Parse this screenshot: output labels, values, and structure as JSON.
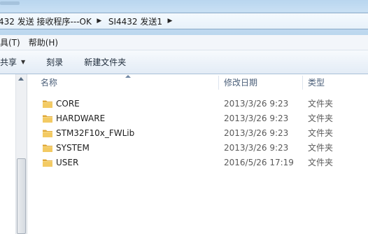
{
  "address": {
    "crumbs": [
      "432 发送 接收程序---OK",
      "SI4432 发送1"
    ]
  },
  "menu": {
    "items": [
      "具(T)",
      "帮助(H)"
    ]
  },
  "toolbar": {
    "share_label": "共享",
    "burn_label": "刻录",
    "new_folder_label": "新建文件夹"
  },
  "columns": {
    "name": "名称",
    "date": "修改日期",
    "type": "类型"
  },
  "files": [
    {
      "name": "CORE",
      "date": "2013/3/26 9:23",
      "type": "文件夹"
    },
    {
      "name": "HARDWARE",
      "date": "2013/3/26 9:23",
      "type": "文件夹"
    },
    {
      "name": "STM32F10x_FWLib",
      "date": "2013/3/26 9:23",
      "type": "文件夹"
    },
    {
      "name": "SYSTEM",
      "date": "2013/3/26 9:23",
      "type": "文件夹"
    },
    {
      "name": "USER",
      "date": "2016/5/26 17:19",
      "type": "文件夹"
    }
  ],
  "icons": {
    "folder": "folder-icon",
    "breadcrumb_separator": "chevron-right-icon",
    "dropdown": "chevron-down-icon",
    "sort": "sort-ascending-icon"
  },
  "colors": {
    "folder": "#e8b84a",
    "header_text": "#4c607a",
    "address_bg": "#c7dff3"
  }
}
